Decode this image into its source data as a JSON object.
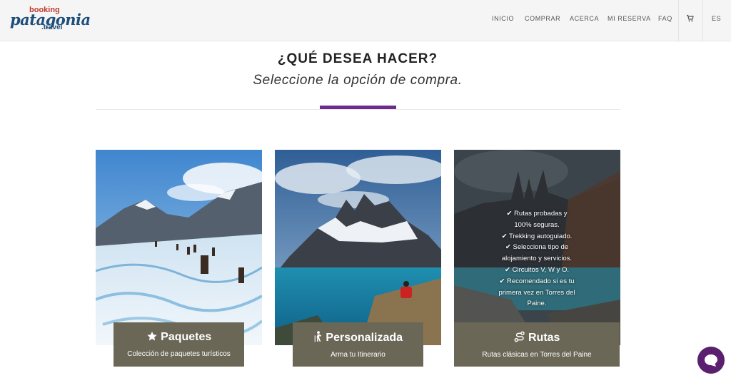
{
  "brand": {
    "booking": "booking",
    "patagonia": "patagonia",
    "travel": ".travel"
  },
  "nav": {
    "inicio": "INICIO",
    "comprar": "COMPRAR",
    "acerca": "ACERCA",
    "mi_reserva": "MI RESERVA",
    "faq": "FAQ",
    "lang": "ES"
  },
  "main": {
    "heading": "¿QUÉ DESEA HACER?",
    "subheading": "Seleccione la opción de compra."
  },
  "cards": [
    {
      "title": "Paquetes",
      "subtitle": "Colección de paquetes turísticos",
      "icon": "star-icon"
    },
    {
      "title": "Personalizada",
      "subtitle": "Arma tu Itinerario",
      "icon": "hiker-icon"
    },
    {
      "title": "Rutas",
      "subtitle": "Rutas clásicas en Torres del Paine",
      "icon": "route-icon"
    }
  ],
  "rutas_tips": {
    "tip1a": "Rutas probadas y",
    "tip1b": "100% seguras.",
    "tip2": "Trekking autoguiado.",
    "tip3a": "Selecciona tipo de",
    "tip3b": "alojamiento y servicios.",
    "tip4": "Circuitos V, W y O.",
    "tip5a": "Recomendado si es tu",
    "tip5b": "primera vez en Torres del",
    "tip5c": "Paine."
  },
  "colors": {
    "accent": "#6d2a8f",
    "card_label": "#6b6757",
    "brand_blue": "#1e4f7a",
    "brand_red": "#c0392b",
    "chat": "#5a1f6e"
  }
}
